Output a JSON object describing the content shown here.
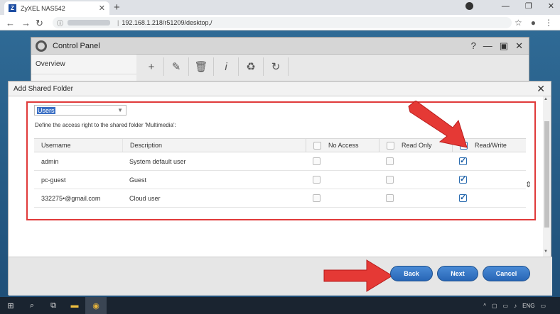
{
  "browser": {
    "tab_title": "ZyXEL NAS542",
    "tab_favicon": "Z",
    "address_host": "192.168.1.218",
    "address_path": "/r51209/desktop,/"
  },
  "control_panel": {
    "title": "Control Panel",
    "sidebar_first": "Overview"
  },
  "dialog": {
    "title": "Add Shared Folder",
    "user_type_selected": "Users",
    "description": "Define the access right to the shared folder 'Multimedia':",
    "columns": {
      "username": "Username",
      "description": "Description",
      "no_access": "No Access",
      "read_only": "Read Only",
      "read_write": "Read/Write"
    },
    "rows": [
      {
        "username": "admin",
        "description": "System default user"
      },
      {
        "username": "pc-guest",
        "description": "Guest"
      },
      {
        "username": "332275•@gmail.com",
        "description": "Cloud user"
      }
    ],
    "buttons": {
      "back": "Back",
      "next": "Next",
      "cancel": "Cancel"
    }
  },
  "taskbar": {
    "lang": "ENG"
  },
  "colors": {
    "accent": "#2866b6",
    "highlight": "#e03a3a"
  }
}
